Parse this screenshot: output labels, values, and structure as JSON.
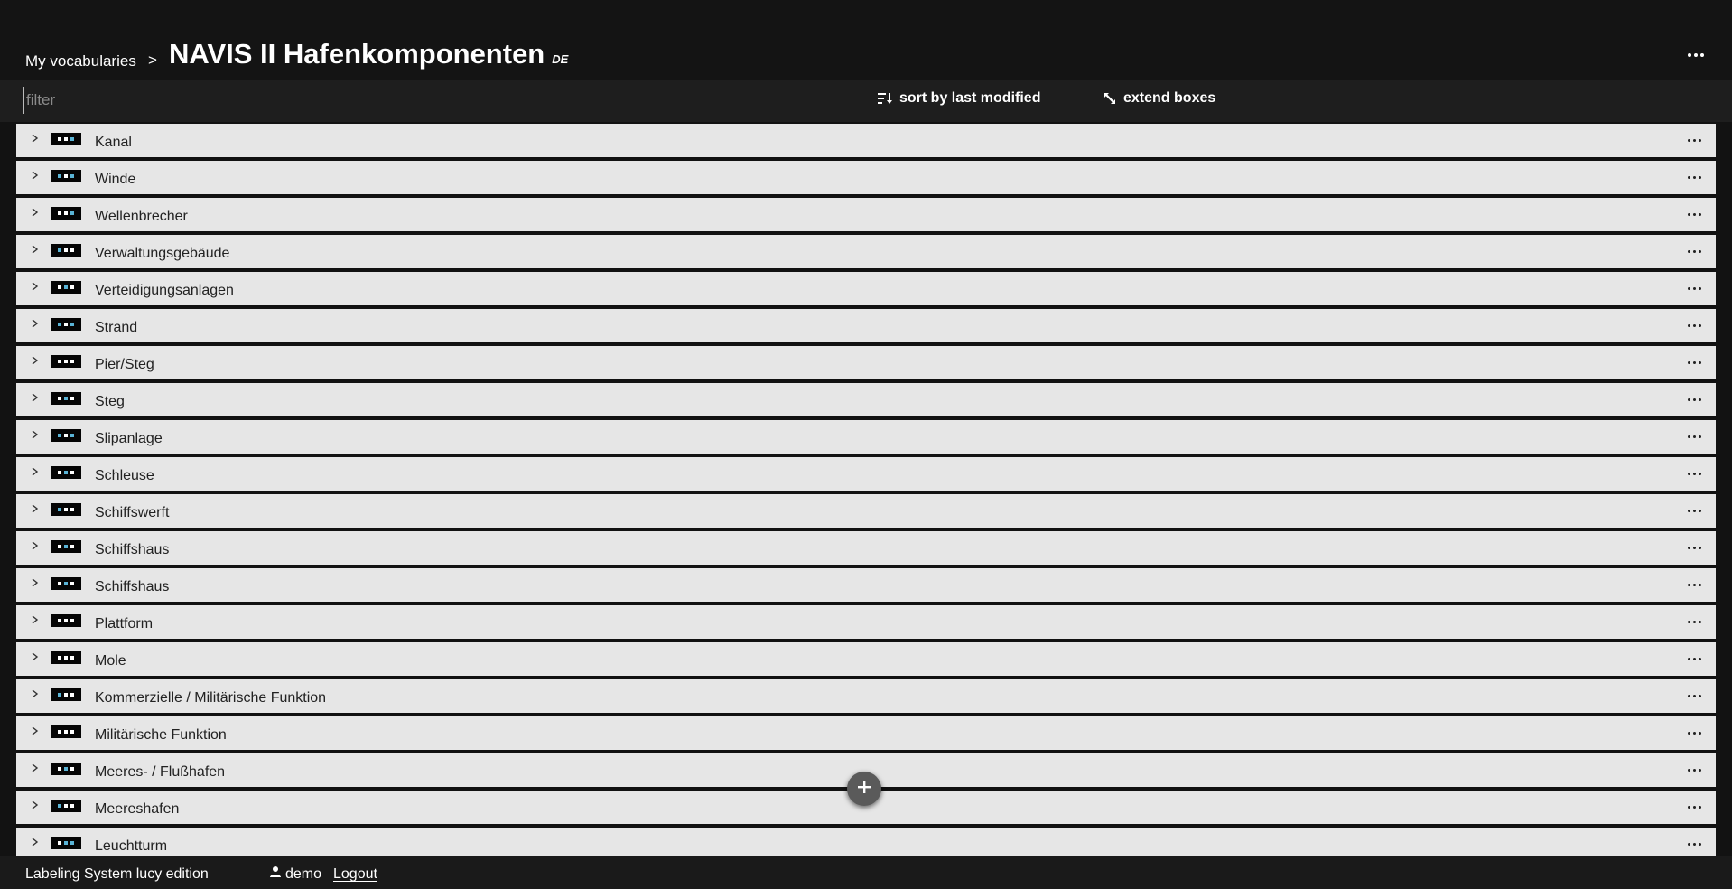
{
  "header": {
    "breadcrumb_link": "My vocabularies",
    "breadcrumb_separator": ">",
    "title": "NAVIS II Hafenkomponenten",
    "language": "DE",
    "menu_icon": "more-horizontal-icon"
  },
  "toolbar": {
    "filter_placeholder": "filter",
    "filter_value": "",
    "sort_label": "sort by last modified",
    "sort_icon": "sort-list-icon",
    "extend_label": "extend boxes",
    "extend_icon": "expand-arrows-icon"
  },
  "concepts": [
    {
      "label": "Kanal"
    },
    {
      "label": "Winde"
    },
    {
      "label": "Wellenbrecher"
    },
    {
      "label": "Verwaltungsgebäude"
    },
    {
      "label": "Verteidigungsanlagen"
    },
    {
      "label": "Strand"
    },
    {
      "label": "Pier/Steg"
    },
    {
      "label": "Steg"
    },
    {
      "label": "Slipanlage"
    },
    {
      "label": "Schleuse"
    },
    {
      "label": "Schiffswerft"
    },
    {
      "label": "Schiffshaus"
    },
    {
      "label": "Schiffshaus"
    },
    {
      "label": "Plattform"
    },
    {
      "label": "Mole"
    },
    {
      "label": "Kommerzielle / Militärische Funktion"
    },
    {
      "label": "Militärische Funktion"
    },
    {
      "label": "Meeres- / Flußhafen"
    },
    {
      "label": "Meereshafen"
    },
    {
      "label": "Leuchtturm"
    }
  ],
  "fab": {
    "icon": "plus-icon"
  },
  "footer": {
    "brand": "Labeling System lucy edition",
    "user_icon": "person-icon",
    "username": "demo",
    "logout": "Logout"
  },
  "colors": {
    "background": "#121212",
    "row_background": "#e6e6e6",
    "accent_cyan": "#5ab4d6"
  }
}
